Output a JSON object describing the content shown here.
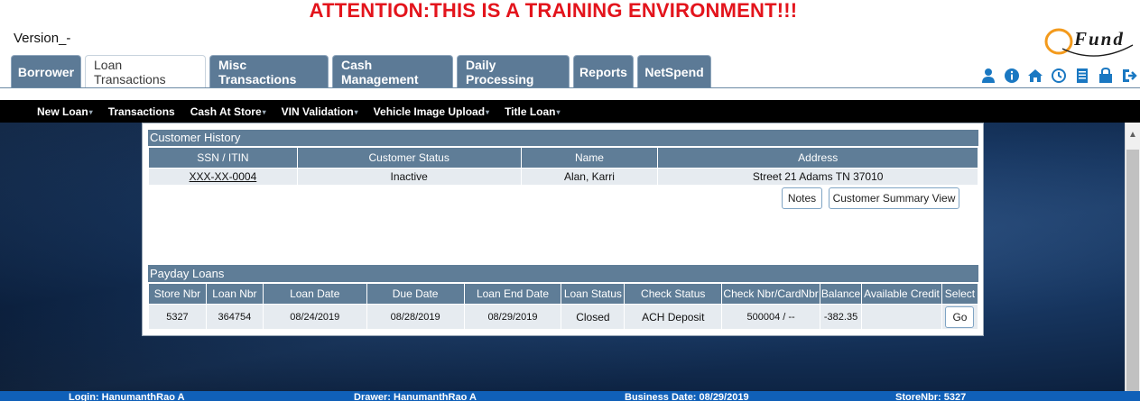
{
  "banner": {
    "attention": "ATTENTION:THIS IS A TRAINING ENVIRONMENT!!!"
  },
  "header": {
    "version": "Version_-",
    "logo_text": "Fund"
  },
  "tabs": [
    {
      "label": "Borrower",
      "active": false
    },
    {
      "label": "Loan Transactions",
      "active": true
    },
    {
      "label": "Misc Transactions",
      "active": false
    },
    {
      "label": "Cash Management",
      "active": false
    },
    {
      "label": "Daily Processing",
      "active": false
    },
    {
      "label": "Reports",
      "active": false
    },
    {
      "label": "NetSpend",
      "active": false
    }
  ],
  "header_icons": [
    "user-icon",
    "info-icon",
    "home-icon",
    "clock-icon",
    "document-icon",
    "lock-icon",
    "logout-icon"
  ],
  "subnav": [
    {
      "label": "New Loan",
      "dropdown": true
    },
    {
      "label": "Transactions",
      "dropdown": false
    },
    {
      "label": "Cash At Store",
      "dropdown": true
    },
    {
      "label": "VIN Validation",
      "dropdown": true
    },
    {
      "label": "Vehicle Image Upload",
      "dropdown": true
    },
    {
      "label": "Title Loan",
      "dropdown": true
    }
  ],
  "customer_history": {
    "title": "Customer History",
    "columns": [
      "SSN / ITIN",
      "Customer Status",
      "Name",
      "Address"
    ],
    "row": {
      "ssn": "XXX-XX-0004",
      "status": "Inactive",
      "name": "Alan,  Karri",
      "address": "Street 21  Adams TN 37010"
    },
    "buttons": {
      "notes": "Notes",
      "summary": "Customer Summary View"
    }
  },
  "payday_loans": {
    "title": "Payday Loans",
    "columns": [
      "Store Nbr",
      "Loan Nbr",
      "Loan Date",
      "Due Date",
      "Loan End Date",
      "Loan Status",
      "Check Status",
      "Check Nbr/CardNbr",
      "Balance",
      "Available Credit",
      "Select"
    ],
    "rows": [
      {
        "store_nbr": "5327",
        "loan_nbr": "364754",
        "loan_date": "08/24/2019",
        "due_date": "08/28/2019",
        "loan_end_date": "08/29/2019",
        "loan_status": "Closed",
        "check_status": "ACH Deposit",
        "check_nbr": "500004 / --",
        "balance": "-382.35",
        "available_credit": "",
        "select_label": "Go"
      }
    ]
  },
  "footer": {
    "login": "Login: HanumanthRao A",
    "drawer": "Drawer: HanumanthRao A",
    "business_date": "Business Date: 08/29/2019",
    "store_nbr": "StoreNbr: 5327"
  },
  "colors": {
    "accent": "#5f7d97",
    "banner_red": "#e3141c",
    "footer_blue": "#1060b8"
  }
}
